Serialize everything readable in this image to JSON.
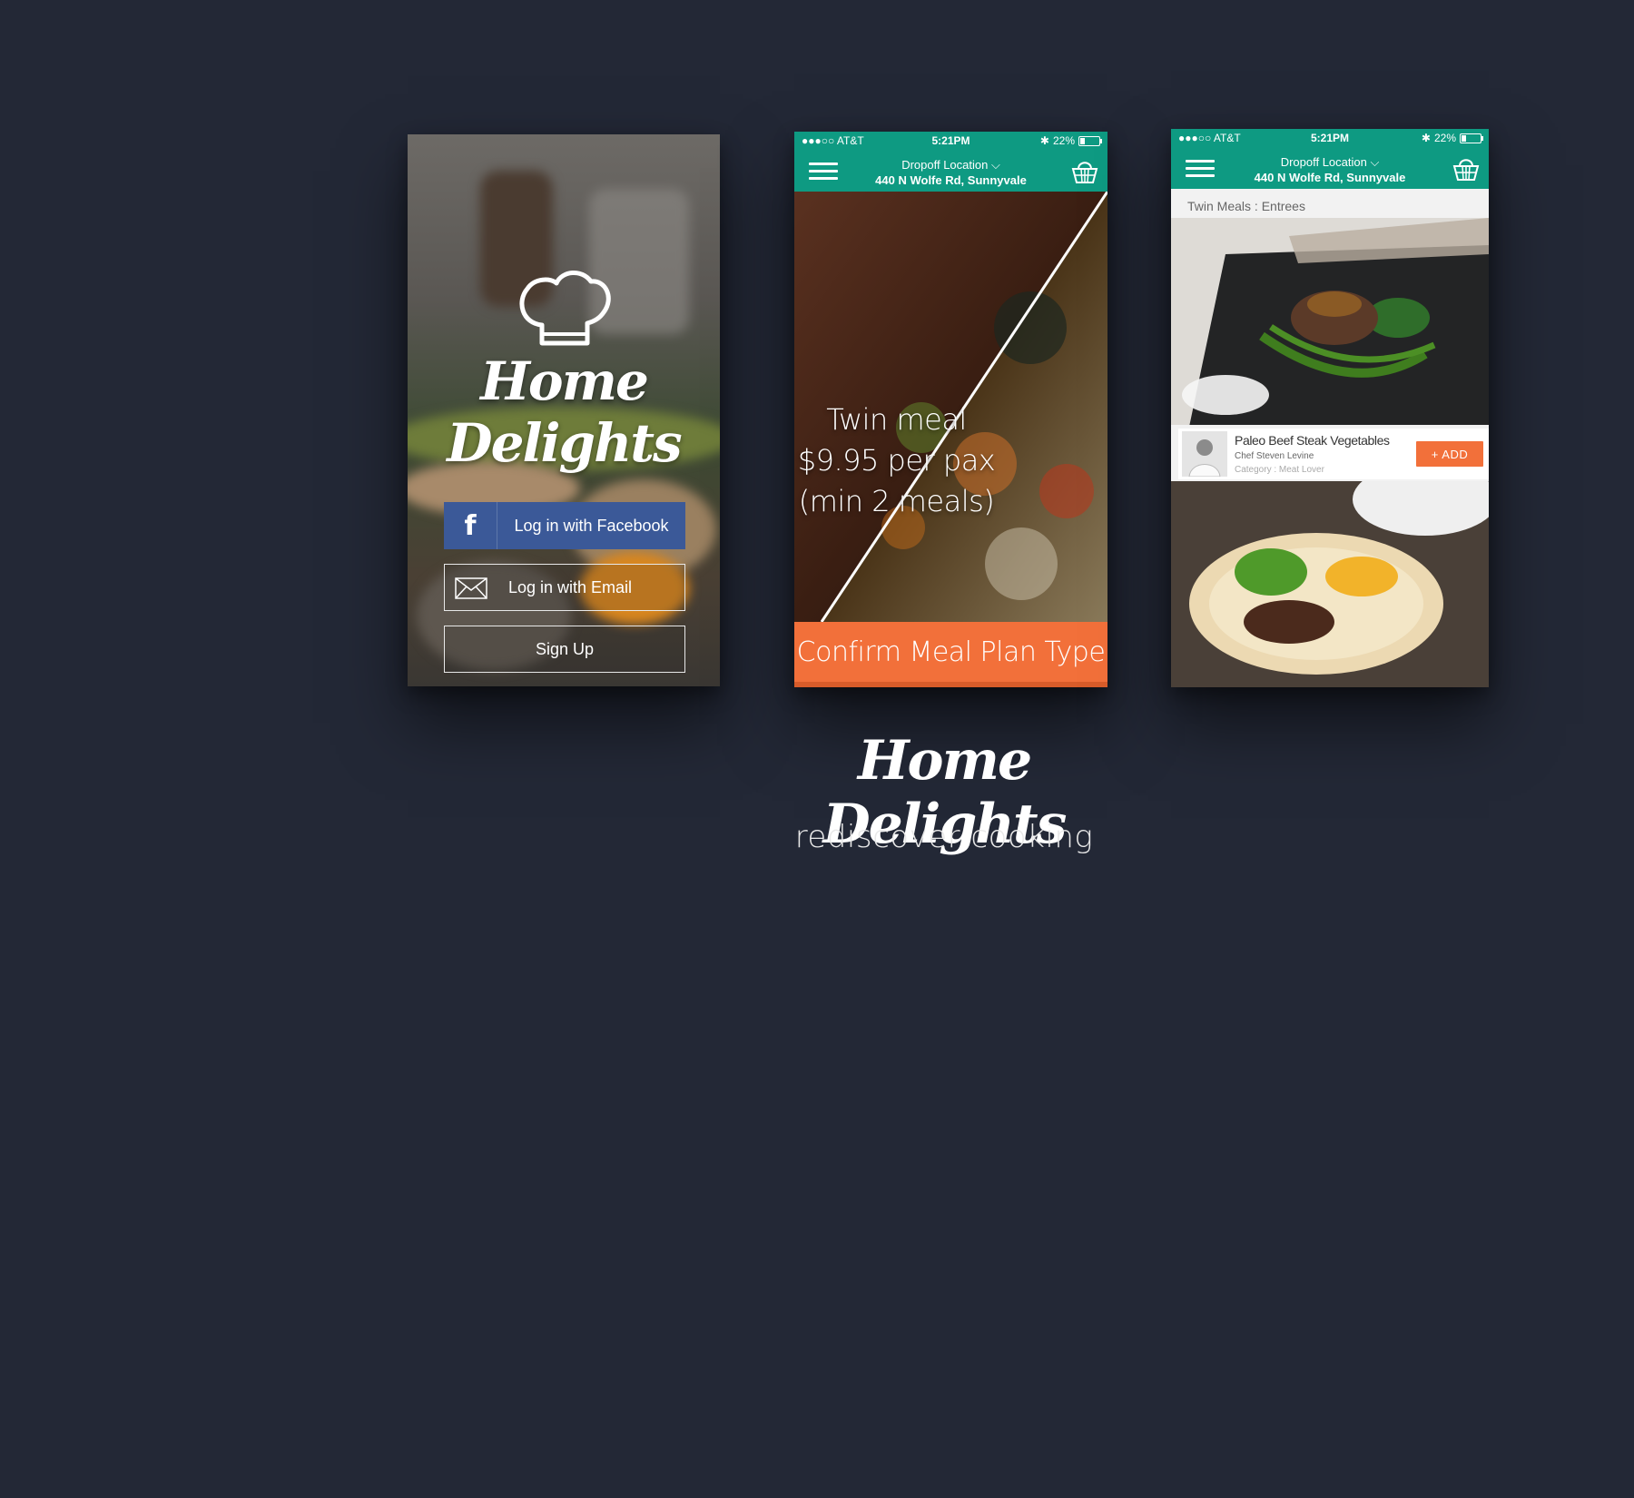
{
  "login": {
    "brand": "Home Delights",
    "facebook_icon": "f",
    "facebook_label": "Log in with Facebook",
    "email_label": "Log in with Email",
    "signup_label": "Sign Up"
  },
  "status_bar": {
    "carrier": "●●●○○ AT&T",
    "time": "5:21PM",
    "battery": "22%"
  },
  "header": {
    "location_label": "Dropoff Location ⌵",
    "address": "440 N Wolfe Rd, Sunnyvale"
  },
  "meal_plan": {
    "promo_line1": "Twin meal",
    "promo_line2": "$9.95 per pax",
    "promo_line3": "(min 2 meals)",
    "cta": "Confirm Meal Plan Type"
  },
  "entrees": {
    "breadcrumb": "Twin Meals : Entrees",
    "dish_name": "Paleo Beef Steak Vegetables",
    "chef": "Chef Steven Levine",
    "category": "Category : Meat Lover",
    "add_label": "+ ADD"
  },
  "footer": {
    "title": "Home Delights",
    "tagline": "rediscover cooking"
  },
  "colors": {
    "background": "#232836",
    "header_teal": "#0e9a82",
    "accent_orange": "#f2703a",
    "facebook_blue": "#3b5998"
  },
  "icons": [
    "chef-hat-icon",
    "facebook-icon",
    "envelope-icon",
    "hamburger-menu-icon",
    "basket-icon",
    "bluetooth-icon",
    "wifi-icon",
    "battery-icon",
    "chevron-down-icon"
  ]
}
